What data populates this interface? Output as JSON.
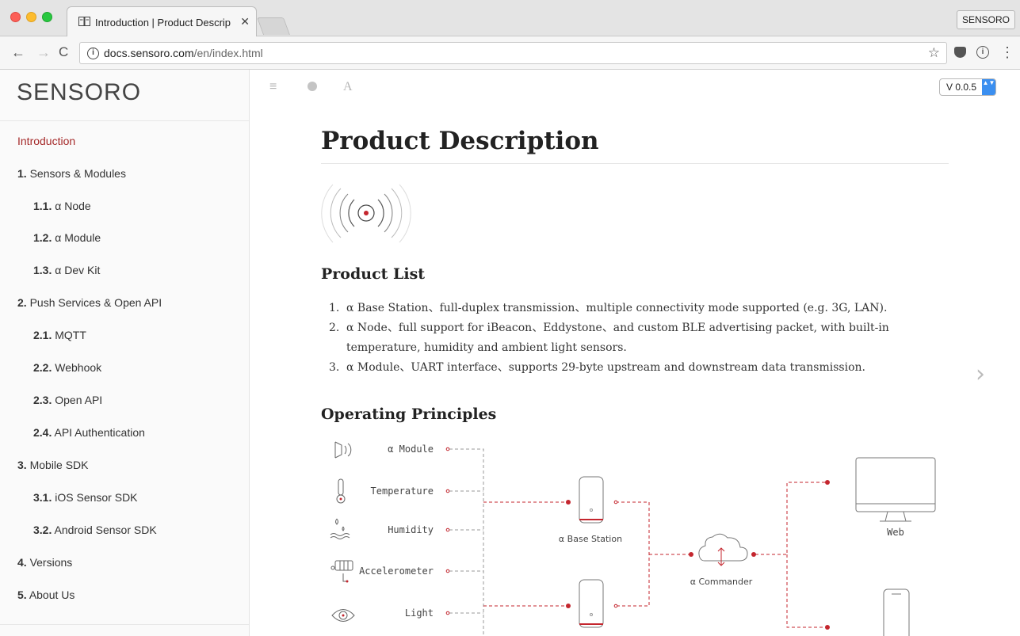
{
  "browser": {
    "tab_title": "Introduction | Product Descrip",
    "tab_close": "✕",
    "profile_label": "SENSORO",
    "url_host": "docs.sensoro.com",
    "url_path": "/en/index.html",
    "back_icon": "←",
    "forward_icon": "→",
    "reload_icon": "C",
    "star_icon": "☆",
    "menu_icon": "⋮"
  },
  "sidebar": {
    "brand": "SENSORO",
    "items": [
      {
        "num": "",
        "label": "Introduction"
      },
      {
        "num": "1.",
        "label": "Sensors & Modules"
      },
      {
        "num": "1.1.",
        "label": "α Node"
      },
      {
        "num": "1.2.",
        "label": "α Module"
      },
      {
        "num": "1.3.",
        "label": "α Dev Kit"
      },
      {
        "num": "2.",
        "label": "Push Services & Open API"
      },
      {
        "num": "2.1.",
        "label": "MQTT"
      },
      {
        "num": "2.2.",
        "label": "Webhook"
      },
      {
        "num": "2.3.",
        "label": "Open API"
      },
      {
        "num": "2.4.",
        "label": "API Authentication"
      },
      {
        "num": "3.",
        "label": "Mobile SDK"
      },
      {
        "num": "3.1.",
        "label": "iOS Sensor SDK"
      },
      {
        "num": "3.2.",
        "label": "Android Sensor SDK"
      },
      {
        "num": "4.",
        "label": "Versions"
      },
      {
        "num": "5.",
        "label": "About Us"
      }
    ]
  },
  "book_toolbar": {
    "menu_icon": "≡",
    "font_icon": "A",
    "version": "V 0.0.5",
    "version_arrow": "▲▼"
  },
  "content": {
    "title": "Product Description",
    "product_list_heading": "Product List",
    "product_list": [
      {
        "n": "1.",
        "text": "α Base Station、full-duplex transmission、multiple connectivity mode supported (e.g. 3G, LAN)."
      },
      {
        "n": "2.",
        "text": "α Node、full support for iBeacon、Eddystone、and custom BLE advertising packet, with built-in temperature, humidity and ambient light sensors."
      },
      {
        "n": "3.",
        "text": "α Module、UART interface、supports 29-byte upstream and downstream data transmission."
      }
    ],
    "principles_heading": "Operating Principles",
    "diagram": {
      "sensors": [
        "α Module",
        "Temperature",
        "Humidity",
        "Accelerometer",
        "Light"
      ],
      "base_station": "α Base Station",
      "commander": "α Commander",
      "web": "Web"
    },
    "next_icon": "›"
  },
  "colors": {
    "accent": "#a52a2a",
    "diagram_red": "#c4262e",
    "select_blue": "#3b8ff0"
  }
}
